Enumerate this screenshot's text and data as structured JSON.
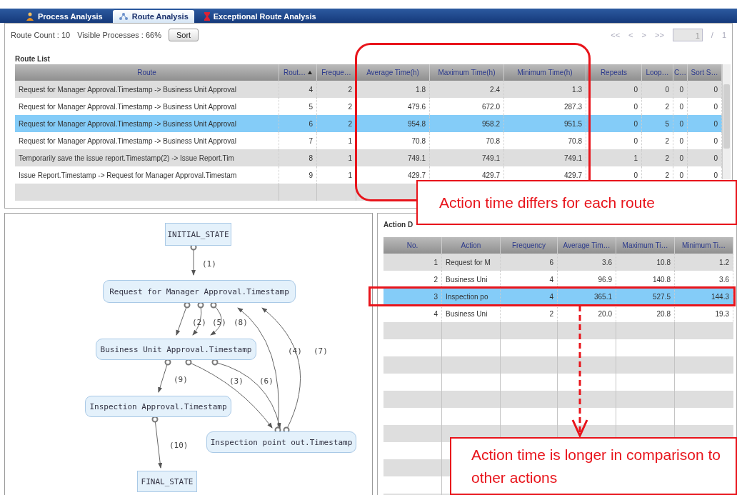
{
  "tabs": [
    {
      "label": "Process Analysis",
      "selected": false
    },
    {
      "label": "Route Analysis",
      "selected": true
    },
    {
      "label": "Exceptional Route Analysis",
      "selected": false
    }
  ],
  "summary": {
    "route_count": "Route Count : 10",
    "visible_processes": "Visible Processes : 66%",
    "sort_button": "Sort"
  },
  "pager": {
    "first": "<<",
    "prev": "<",
    "next": ">",
    "last": ">>",
    "page": "1",
    "separator": "/",
    "total": "1"
  },
  "route_list": {
    "title": "Route List",
    "columns": [
      {
        "label": "Route",
        "sorted": false
      },
      {
        "label": "Rout…",
        "sorted": true
      },
      {
        "label": "Freque…",
        "sorted": false
      },
      {
        "label": "Average Time(h)",
        "sorted": false
      },
      {
        "label": "Maximum Time(h)",
        "sorted": false
      },
      {
        "label": "Minimum Time(h)",
        "sorted": false
      },
      {
        "label": "Repeats",
        "sorted": false
      },
      {
        "label": "Loop…",
        "sorted": false
      },
      {
        "label": "C…",
        "sorted": false
      },
      {
        "label": "Sort S…",
        "sorted": false
      }
    ],
    "rows": [
      {
        "selected": false,
        "cells": [
          "Request for Manager Approval.Timestamp -> Business Unit Approval",
          "4",
          "2",
          "1.8",
          "2.4",
          "1.3",
          "0",
          "0",
          "0",
          "0"
        ]
      },
      {
        "selected": false,
        "cells": [
          "Request for Manager Approval.Timestamp -> Business Unit Approval",
          "5",
          "2",
          "479.6",
          "672.0",
          "287.3",
          "0",
          "2",
          "0",
          "0"
        ]
      },
      {
        "selected": true,
        "cells": [
          "Request for Manager Approval.Timestamp -> Business Unit Approval",
          "6",
          "2",
          "954.8",
          "958.2",
          "951.5",
          "0",
          "5",
          "0",
          "0"
        ]
      },
      {
        "selected": false,
        "cells": [
          "Request for Manager Approval.Timestamp -> Business Unit Approval",
          "7",
          "1",
          "70.8",
          "70.8",
          "70.8",
          "0",
          "2",
          "0",
          "0"
        ]
      },
      {
        "selected": false,
        "cells": [
          "Temporarily save the issue report.Timestamp(2) -> Issue Report.Tim",
          "8",
          "1",
          "749.1",
          "749.1",
          "749.1",
          "1",
          "2",
          "0",
          "0"
        ]
      },
      {
        "selected": false,
        "cells": [
          "Issue Report.Timestamp -> Request for Manager Approval.Timestam",
          "9",
          "1",
          "429.7",
          "429.7",
          "429.7",
          "0",
          "2",
          "0",
          "0"
        ]
      }
    ]
  },
  "diagram": {
    "nodes": [
      {
        "label": "INITIAL_STATE",
        "kind": "state"
      },
      {
        "label": "Request for Manager Approval.Timestamp",
        "kind": "action"
      },
      {
        "label": "Business Unit Approval.Timestamp",
        "kind": "action"
      },
      {
        "label": "Inspection Approval.Timestamp",
        "kind": "action"
      },
      {
        "label": "Inspection point out.Timestamp",
        "kind": "action"
      },
      {
        "label": "FINAL_STATE",
        "kind": "state"
      }
    ],
    "edges": [
      {
        "label": "(1)"
      },
      {
        "label": "(2)"
      },
      {
        "label": "(5)"
      },
      {
        "label": "(8)"
      },
      {
        "label": "(4)"
      },
      {
        "label": "(7)"
      },
      {
        "label": "(9)"
      },
      {
        "label": "(3)"
      },
      {
        "label": "(6)"
      },
      {
        "label": "(10)"
      }
    ]
  },
  "action_details": {
    "title": "Action D",
    "columns": [
      "No.",
      "Action",
      "Frequency",
      "Average Tim…",
      "Maximum Ti…",
      "Minimum Ti…"
    ],
    "rows": [
      {
        "selected": false,
        "cells": [
          "1",
          "Request for M",
          "6",
          "3.6",
          "10.8",
          "1.2"
        ]
      },
      {
        "selected": false,
        "cells": [
          "2",
          "Business Uni",
          "4",
          "96.9",
          "140.8",
          "3.6"
        ]
      },
      {
        "selected": true,
        "cells": [
          "3",
          "Inspection po",
          "4",
          "365.1",
          "527.5",
          "144.3"
        ]
      },
      {
        "selected": false,
        "cells": [
          "4",
          "Business Uni",
          "2",
          "20.0",
          "20.8",
          "19.3"
        ]
      }
    ]
  },
  "annotations": [
    {
      "kind": "frame"
    },
    {
      "kind": "callout",
      "text": "Action time differs for each route"
    },
    {
      "kind": "frame"
    },
    {
      "kind": "arrow"
    },
    {
      "kind": "callout",
      "text": "Action time is longer in comparison to other actions"
    }
  ]
}
